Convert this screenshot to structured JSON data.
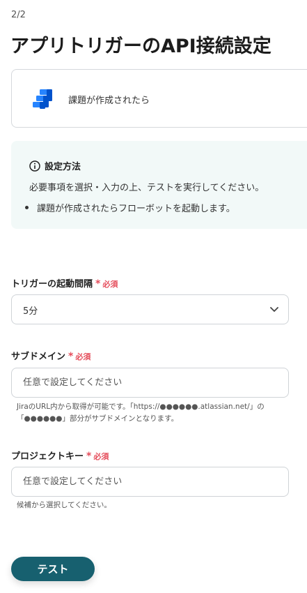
{
  "step_indicator": "2/2",
  "page_title": "アプリトリガーのAPI接続設定",
  "app_card": {
    "icon": "jira-icon",
    "label": "課題が作成されたら"
  },
  "info": {
    "icon": "info-icon",
    "heading": "設定方法",
    "line": "必要事項を選択・入力の上、テストを実行してください。",
    "bullets": [
      "課題が作成されたらフローボットを起動します。"
    ]
  },
  "fields": {
    "trigger_interval": {
      "label": "トリガーの起動間隔",
      "required_mark": "*",
      "required_text": "必須",
      "value": "5分",
      "icon": "chevron-down-icon"
    },
    "subdomain": {
      "label": "サブドメイン",
      "required_mark": "*",
      "required_text": "必須",
      "placeholder": "任意で設定してください",
      "help_line1": "JiraのURL内から取得が可能です。「https://●●●●●●.atlassian.net/」の",
      "help_line2": "「●●●●●●」部分がサブドメインとなります。"
    },
    "project_key": {
      "label": "プロジェクトキー",
      "required_mark": "*",
      "required_text": "必須",
      "placeholder": "任意で設定してください",
      "help": "候補から選択してください。"
    }
  },
  "test_button": "テスト",
  "colors": {
    "accent": "#17606f",
    "required": "#e54d5b",
    "info_bg": "#f2f9f8",
    "jira_blue": "#2684ff"
  }
}
